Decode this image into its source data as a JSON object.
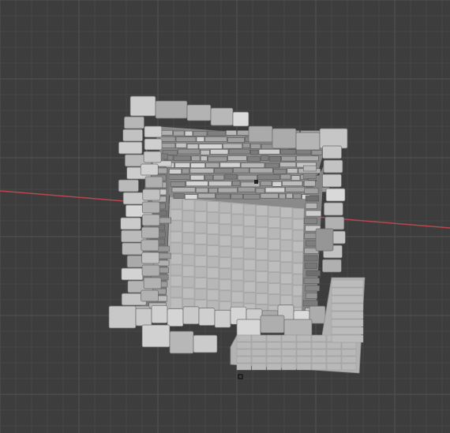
{
  "viewport": {
    "background": "#3d3d3d",
    "grid_minor_color": "#474747",
    "grid_major_color": "#525252",
    "x_axis_color": "#b8474f",
    "mesh_base_color": "#a9a9a9",
    "mesh_light_color": "#d0d0d0",
    "mesh_shadow_color": "#5e5e5e",
    "origin_marker_icon": "object-origin-icon"
  }
}
